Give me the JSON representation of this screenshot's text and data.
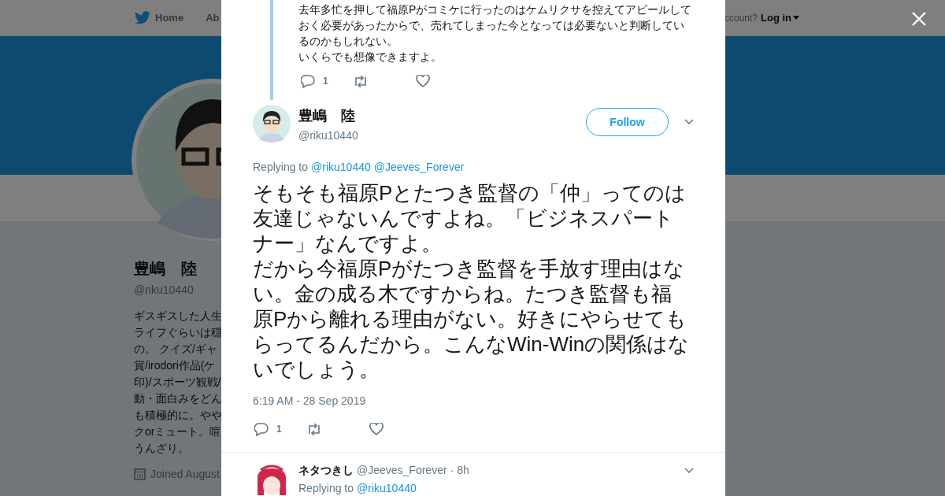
{
  "nav": {
    "home": "Home",
    "about": "Ab",
    "account": "ccount?",
    "login": "Log in"
  },
  "profile": {
    "name": "豊嶋　陸",
    "handle": "@riku10440",
    "bio_lines": [
      "ギスギスした人生",
      "ライフぐらいは穏",
      "の。 クイズ/ギャ",
      "賞/irodori作品(ケ",
      "印)/スポーツ観戦/",
      "動・面白みをどん",
      "も積極的に。やや",
      "クorミュート。喧",
      "うんざり。"
    ],
    "joined": "Joined August"
  },
  "thread": [
    {
      "paragraphs": [
        "去年多忙を押して福原Pがコミケに行ったのはケムリクサを控えてアピールしておく必要があったからで、売れてしまった今となっては必要ないと判断しているのかもしれない。",
        "いくらでも想像できますよ。"
      ],
      "reply_count": "1"
    },
    {
      "name": "豊嶋　陸",
      "handle": "@riku10440",
      "follow": "Follow",
      "replying_label": "Replying to",
      "replying_to": [
        "@riku10440",
        "@Jeeves_Forever"
      ],
      "paragraphs": [
        "そもそも福原Pとたつき監督の「仲」ってのは友達じゃないんですよね。「ビジネスパートナー」なんですよ。",
        "だから今福原Pがたつき監督を手放す理由はない。金の成る木ですからね。たつき監督も福原Pから離れる理由がない。好きにやらせてもらってるんだから。こんなWin-Winの関係はないでしょう。"
      ],
      "time": "6:19 AM - 28 Sep 2019",
      "reply_count": "1"
    },
    {
      "name": "ネタつきし",
      "handle": "@Jeeves_Forever",
      "age": "· 8h",
      "replying_label": "Replying to",
      "replying_to": [
        "@riku10440"
      ]
    }
  ]
}
